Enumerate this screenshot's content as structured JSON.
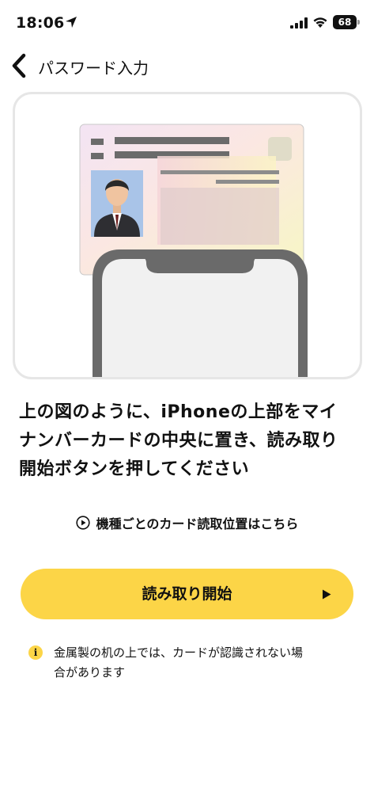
{
  "status_bar": {
    "time": "18:06",
    "battery": "68",
    "battery_level": 0.68
  },
  "nav": {
    "title": "パスワード入力"
  },
  "illustration": {
    "icons": [
      "id-card-icon",
      "person-photo-icon",
      "phone-icon"
    ]
  },
  "instruction": {
    "line1": "上の図のように、iPhoneの上部をマイ",
    "line2": "ナンバーカードの中央に置き、読み取り",
    "line3": "開始ボタンを押してください"
  },
  "model_link": {
    "label": "機種ごとのカード読取位置はこちら",
    "icon": "play-circle-icon"
  },
  "start_button": {
    "label": "読み取り開始",
    "icon": "play-icon"
  },
  "note": {
    "line1": "金属製の机の上では、カードが認識されない場",
    "line2": "合があります",
    "icon": "info-icon"
  },
  "colors": {
    "accent": "#fcd547",
    "text": "#111111",
    "frame_border": "#e6e6e6"
  }
}
